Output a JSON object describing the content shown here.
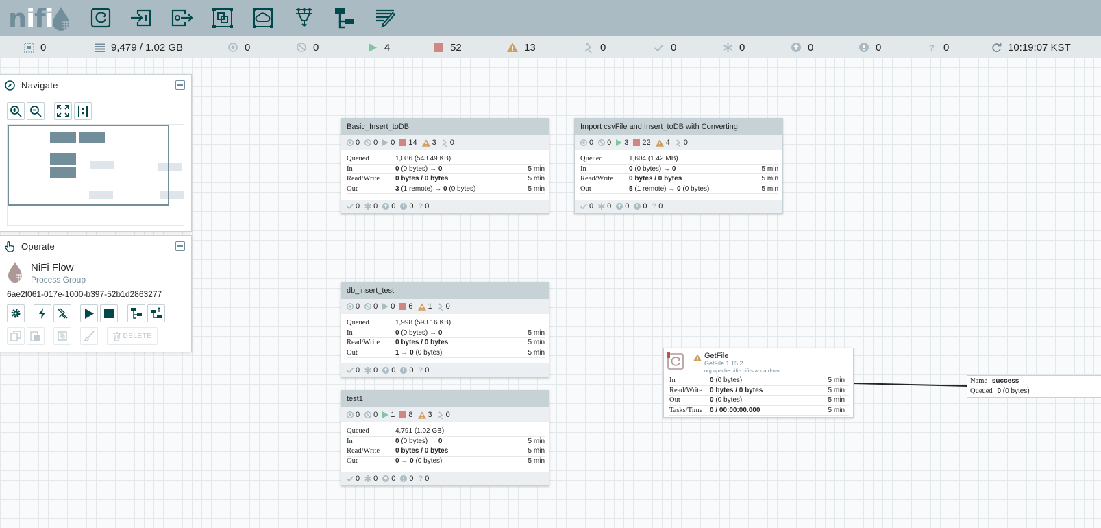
{
  "app": {
    "logo_text": "nifi"
  },
  "colors": {
    "header": "#aabbc3",
    "icon_dark": "#004849",
    "accent_muted": "#728e9b",
    "run_green": "#7dc7a0",
    "stop_red": "#d18686",
    "warn_orange": "#cf9f5d"
  },
  "toolbar": {
    "items": [
      {
        "name": "processor-icon"
      },
      {
        "name": "input-port-icon"
      },
      {
        "name": "output-port-icon"
      },
      {
        "name": "process-group-icon"
      },
      {
        "name": "remote-process-group-icon"
      },
      {
        "name": "funnel-icon"
      },
      {
        "name": "template-icon"
      },
      {
        "name": "label-icon"
      }
    ]
  },
  "status": {
    "active_threads": "0",
    "queued": "9,479 / 1.02 GB",
    "transmitting": "0",
    "not_transmitting": "0",
    "running": "4",
    "stopped": "52",
    "invalid": "13",
    "disabled": "0",
    "up_to_date": "0",
    "locally_modified": "0",
    "stale": "0",
    "locally_modified_stale": "0",
    "sync_failure": "0",
    "refreshed": "10:19:07 KST"
  },
  "navigate": {
    "title": "Navigate"
  },
  "operate": {
    "title": "Operate",
    "name": "NiFi Flow",
    "type": "Process Group",
    "id": "6ae2f061-017e-1000-b397-52b1d2863277",
    "delete_label": "DELETE"
  },
  "process_groups": [
    {
      "title": "Basic_Insert_toDB",
      "stats": {
        "transmitting": "0",
        "not_transmitting": "0",
        "running": "0",
        "stopped": "14",
        "invalid": "3",
        "disabled": "0"
      },
      "queued_count": "1,086",
      "queued_size": "(543.49 KB)",
      "in_count": "0",
      "in_size": "(0 bytes)",
      "in_arrow": "→",
      "in_dest": "0",
      "in_time": "5 min",
      "rw": "0 bytes / 0 bytes",
      "rw_time": "5 min",
      "out_count": "3",
      "out_extra": "(1 remote)",
      "out_arrow": "→",
      "out_dest": "0",
      "out_size": "(0 bytes)",
      "out_time": "5 min",
      "footer": {
        "up_to_date": "0",
        "locally_modified": "0",
        "stale": "0",
        "locally_modified_stale": "0",
        "sync_failure": "0"
      }
    },
    {
      "title": "Import csvFile and Insert_toDB with Converting",
      "stats": {
        "transmitting": "0",
        "not_transmitting": "0",
        "running": "3",
        "stopped": "22",
        "invalid": "4",
        "disabled": "0"
      },
      "queued_count": "1,604",
      "queued_size": "(1.42 MB)",
      "in_count": "0",
      "in_size": "(0 bytes)",
      "in_arrow": "→",
      "in_dest": "0",
      "in_time": "5 min",
      "rw": "0 bytes / 0 bytes",
      "rw_time": "5 min",
      "out_count": "5",
      "out_extra": "(1 remote)",
      "out_arrow": "→",
      "out_dest": "0",
      "out_size": "(0 bytes)",
      "out_time": "5 min",
      "footer": {
        "up_to_date": "0",
        "locally_modified": "0",
        "stale": "0",
        "locally_modified_stale": "0",
        "sync_failure": "0"
      }
    },
    {
      "title": "db_insert_test",
      "stats": {
        "transmitting": "0",
        "not_transmitting": "0",
        "running": "0",
        "stopped": "6",
        "invalid": "1",
        "disabled": "0"
      },
      "queued_count": "1,998",
      "queued_size": "(593.16 KB)",
      "in_count": "0",
      "in_size": "(0 bytes)",
      "in_arrow": "→",
      "in_dest": "0",
      "in_time": "5 min",
      "rw": "0 bytes / 0 bytes",
      "rw_time": "5 min",
      "out_count": "1",
      "out_extra": "",
      "out_arrow": "→",
      "out_dest": "0",
      "out_size": "(0 bytes)",
      "out_time": "5 min",
      "footer": {
        "up_to_date": "0",
        "locally_modified": "0",
        "stale": "0",
        "locally_modified_stale": "0",
        "sync_failure": "0"
      }
    },
    {
      "title": "test1",
      "stats": {
        "transmitting": "0",
        "not_transmitting": "0",
        "running": "1",
        "stopped": "8",
        "invalid": "3",
        "disabled": "0"
      },
      "queued_count": "4,791",
      "queued_size": "(1.02 GB)",
      "in_count": "0",
      "in_size": "(0 bytes)",
      "in_arrow": "→",
      "in_dest": "0",
      "in_time": "5 min",
      "rw": "0 bytes / 0 bytes",
      "rw_time": "5 min",
      "out_count": "0",
      "out_extra": "",
      "out_arrow": "→",
      "out_dest": "0",
      "out_size": "(0 bytes)",
      "out_time": "5 min",
      "footer": {
        "up_to_date": "0",
        "locally_modified": "0",
        "stale": "0",
        "locally_modified_stale": "0",
        "sync_failure": "0"
      }
    }
  ],
  "labels": {
    "queued": "Queued",
    "in": "In",
    "read_write": "Read/Write",
    "out": "Out",
    "tasks_time": "Tasks/Time"
  },
  "processor": {
    "name": "GetFile",
    "type": "GetFile 1.15.2",
    "bundle": "org.apache.nifi - nifi-standard-nar",
    "in": "0",
    "in_size": "(0 bytes)",
    "in_time": "5 min",
    "rw": "0 bytes / 0 bytes",
    "rw_time": "5 min",
    "out": "0",
    "out_size": "(0 bytes)",
    "out_time": "5 min",
    "tasks": "0 / 00:00:00.000",
    "tasks_time": "5 min"
  },
  "connection": {
    "name_label": "Name",
    "name": "success",
    "queued_label": "Queued",
    "queued": "0",
    "queued_size": "(0 bytes)"
  }
}
